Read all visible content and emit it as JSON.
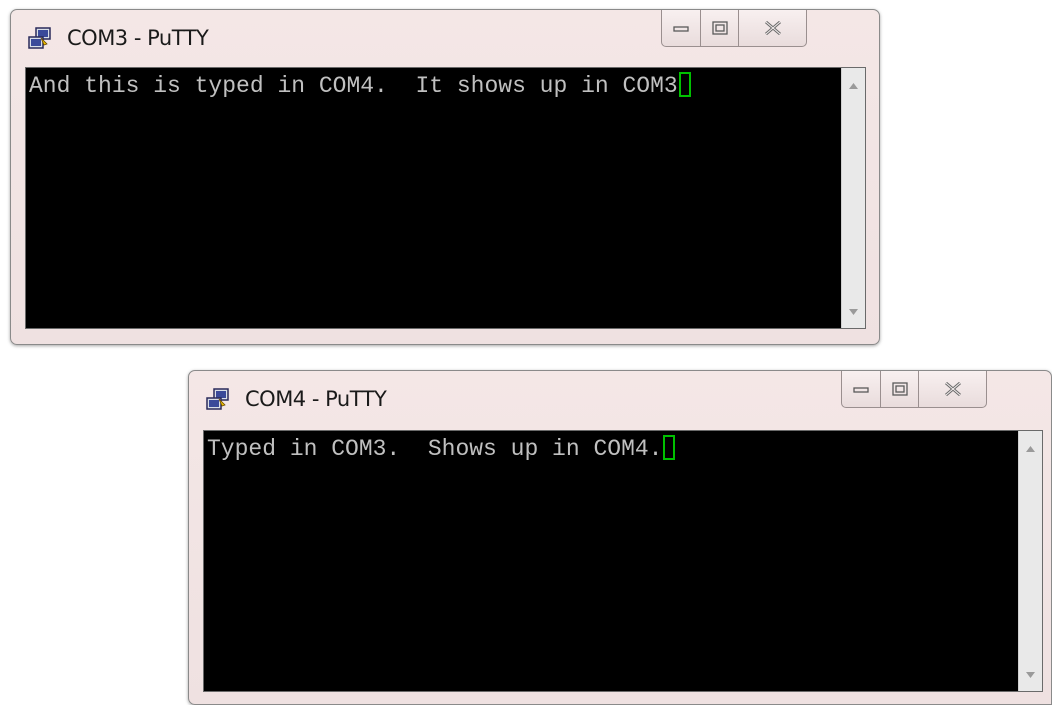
{
  "windows": [
    {
      "title": "COM3 - PuTTY",
      "terminal_text": "And this is typed in COM4.  It shows up in COM3"
    },
    {
      "title": "COM4 - PuTTY",
      "terminal_text": "Typed in COM3.  Shows up in COM4."
    }
  ],
  "icons": {
    "app": "putty-icon",
    "minimize": "minimize-icon",
    "maximize": "maximize-icon",
    "close": "close-icon",
    "scroll_up": "scroll-up-arrow-icon",
    "scroll_down": "scroll-down-arrow-icon"
  },
  "colors": {
    "terminal_bg": "#000000",
    "terminal_text": "#c0c0c0",
    "cursor": "#00c000",
    "window_frame": "#f2e4e4"
  }
}
